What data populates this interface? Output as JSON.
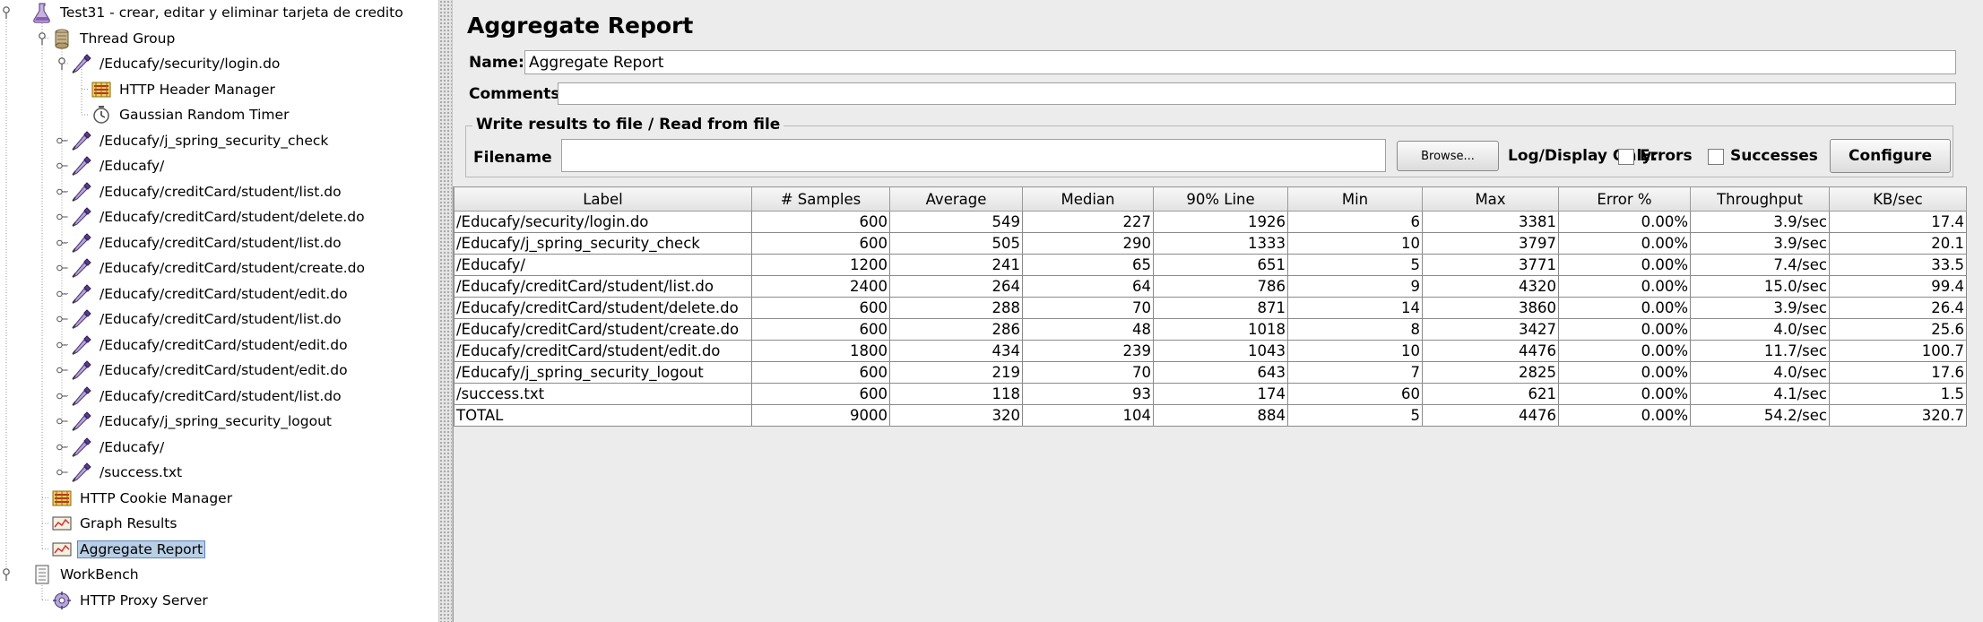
{
  "tree": {
    "items": [
      {
        "label": "Test31 - crear, editar y eliminar tarjeta de credito",
        "icon": "test-plan-icon"
      },
      {
        "label": "Thread Group",
        "icon": "thread-group-icon"
      },
      {
        "label": "/Educafy/security/login.do",
        "icon": "sampler-pipette-icon"
      },
      {
        "label": "HTTP Header Manager",
        "icon": "config-element-icon"
      },
      {
        "label": "Gaussian Random Timer",
        "icon": "timer-clock-icon"
      },
      {
        "label": "/Educafy/j_spring_security_check",
        "icon": "sampler-pipette-icon"
      },
      {
        "label": "/Educafy/",
        "icon": "sampler-pipette-icon"
      },
      {
        "label": "/Educafy/creditCard/student/list.do",
        "icon": "sampler-pipette-icon"
      },
      {
        "label": "/Educafy/creditCard/student/delete.do",
        "icon": "sampler-pipette-icon"
      },
      {
        "label": "/Educafy/creditCard/student/list.do",
        "icon": "sampler-pipette-icon"
      },
      {
        "label": "/Educafy/creditCard/student/create.do",
        "icon": "sampler-pipette-icon"
      },
      {
        "label": "/Educafy/creditCard/student/edit.do",
        "icon": "sampler-pipette-icon"
      },
      {
        "label": "/Educafy/creditCard/student/list.do",
        "icon": "sampler-pipette-icon"
      },
      {
        "label": "/Educafy/creditCard/student/edit.do",
        "icon": "sampler-pipette-icon"
      },
      {
        "label": "/Educafy/creditCard/student/edit.do",
        "icon": "sampler-pipette-icon"
      },
      {
        "label": "/Educafy/creditCard/student/list.do",
        "icon": "sampler-pipette-icon"
      },
      {
        "label": "/Educafy/j_spring_security_logout",
        "icon": "sampler-pipette-icon"
      },
      {
        "label": "/Educafy/",
        "icon": "sampler-pipette-icon"
      },
      {
        "label": "/success.txt",
        "icon": "sampler-pipette-icon"
      },
      {
        "label": "HTTP Cookie Manager",
        "icon": "config-element-icon"
      },
      {
        "label": "Graph Results",
        "icon": "listener-graph-icon"
      },
      {
        "label": "Aggregate Report",
        "icon": "listener-graph-icon",
        "selected": true
      },
      {
        "label": "WorkBench",
        "icon": "workbench-icon"
      },
      {
        "label": "HTTP Proxy Server",
        "icon": "proxy-server-icon"
      }
    ]
  },
  "panel": {
    "title": "Aggregate Report",
    "name_label": "Name:",
    "name_value": "Aggregate Report",
    "comments_label": "Comments:",
    "comments_value": "",
    "group_title": "Write results to file / Read from file",
    "filename_label": "Filename",
    "filename_value": "",
    "browse_label": "Browse...",
    "log_display_label": "Log/Display Only:",
    "errors_label": "Errors",
    "successes_label": "Successes",
    "configure_label": "Configure"
  },
  "table": {
    "columns": [
      "Label",
      "# Samples",
      "Average",
      "Median",
      "90% Line",
      "Min",
      "Max",
      "Error %",
      "Throughput",
      "KB/sec"
    ],
    "rows": [
      [
        "/Educafy/security/login.do",
        "600",
        "549",
        "227",
        "1926",
        "6",
        "3381",
        "0.00%",
        "3.9/sec",
        "17.4"
      ],
      [
        "/Educafy/j_spring_security_check",
        "600",
        "505",
        "290",
        "1333",
        "10",
        "3797",
        "0.00%",
        "3.9/sec",
        "20.1"
      ],
      [
        "/Educafy/",
        "1200",
        "241",
        "65",
        "651",
        "5",
        "3771",
        "0.00%",
        "7.4/sec",
        "33.5"
      ],
      [
        "/Educafy/creditCard/student/list.do",
        "2400",
        "264",
        "64",
        "786",
        "9",
        "4320",
        "0.00%",
        "15.0/sec",
        "99.4"
      ],
      [
        "/Educafy/creditCard/student/delete.do",
        "600",
        "288",
        "70",
        "871",
        "14",
        "3860",
        "0.00%",
        "3.9/sec",
        "26.4"
      ],
      [
        "/Educafy/creditCard/student/create.do",
        "600",
        "286",
        "48",
        "1018",
        "8",
        "3427",
        "0.00%",
        "4.0/sec",
        "25.6"
      ],
      [
        "/Educafy/creditCard/student/edit.do",
        "1800",
        "434",
        "239",
        "1043",
        "10",
        "4476",
        "0.00%",
        "11.7/sec",
        "100.7"
      ],
      [
        "/Educafy/j_spring_security_logout",
        "600",
        "219",
        "70",
        "643",
        "7",
        "2825",
        "0.00%",
        "4.0/sec",
        "17.6"
      ],
      [
        "/success.txt",
        "600",
        "118",
        "93",
        "174",
        "60",
        "621",
        "0.00%",
        "4.1/sec",
        "1.5"
      ],
      [
        "TOTAL",
        "9000",
        "320",
        "104",
        "884",
        "5",
        "4476",
        "0.00%",
        "54.2/sec",
        "320.7"
      ]
    ]
  }
}
